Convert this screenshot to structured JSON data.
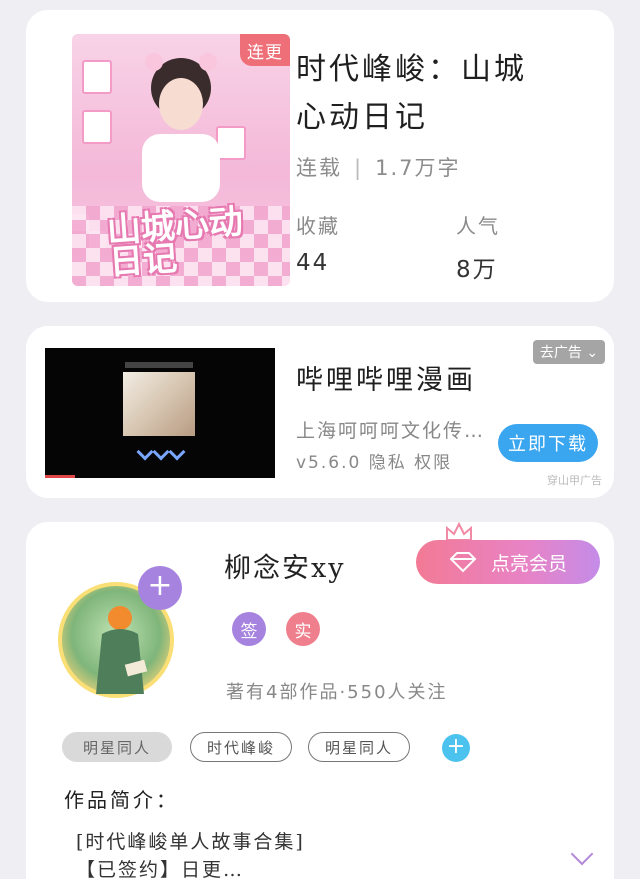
{
  "book": {
    "cover_badge": "连更",
    "title_line1": "时代峰峻：山城",
    "title_line2": "心动日记",
    "status": "连载",
    "word_count": "1.7万字",
    "favorites_label": "收藏",
    "favorites_value": "44",
    "popularity_label": "人气",
    "popularity_value": "8万",
    "cover_art_text": "山城心动日记",
    "colors": {
      "cover_pink": "#f4b8d8",
      "badge_red": "#ee6f78"
    }
  },
  "ad": {
    "remove_ad_label": "去广告 ⌄",
    "title": "哔哩哔哩漫画",
    "company": "上海呵呵呵文化传…",
    "version_line": "v5.6.0  隐私  权限",
    "download_label": "立即下载",
    "source": "穿山甲广告",
    "colors": {
      "download_blue": "#3aa6f0"
    }
  },
  "author": {
    "name": "柳念安xy",
    "follow_icon": "+",
    "vip_label": "点亮会员",
    "badge_signed": "签",
    "badge_verified": "实",
    "stats": "著有4部作品·550人关注",
    "tags": [
      "明星同人",
      "时代峰峻",
      "明星同人"
    ],
    "tag_add_icon": "+",
    "intro_label": "作品简介：",
    "intro_line1": "[时代峰峻单人故事合集]",
    "intro_line2": "【已签约】日更…",
    "colors": {
      "vip_start": "#f27a95",
      "vip_end": "#c48ce8",
      "signed": "#a783e0",
      "verified": "#ef7f8c",
      "tag_add": "#4cc3ef"
    }
  }
}
